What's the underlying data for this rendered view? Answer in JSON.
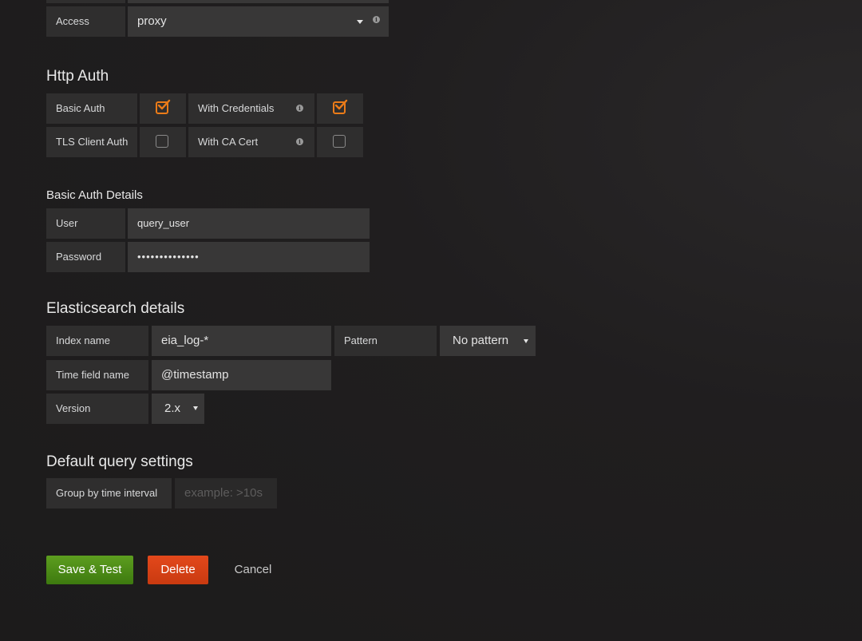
{
  "access": {
    "label": "Access",
    "value": "proxy"
  },
  "http_auth": {
    "title": "Http Auth",
    "basic_auth": {
      "label": "Basic Auth",
      "checked": true
    },
    "with_credentials": {
      "label": "With Credentials",
      "checked": true
    },
    "tls_client_auth": {
      "label": "TLS Client Auth",
      "checked": false
    },
    "with_ca_cert": {
      "label": "With CA Cert",
      "checked": false
    }
  },
  "basic_auth_details": {
    "title": "Basic Auth Details",
    "user_label": "User",
    "user_value": "query_user",
    "password_label": "Password",
    "password_value": "••••••••••••••"
  },
  "elasticsearch": {
    "title": "Elasticsearch details",
    "index_name_label": "Index name",
    "index_name_value": "eia_log-*",
    "pattern_label": "Pattern",
    "pattern_value": "No pattern",
    "time_field_label": "Time field name",
    "time_field_value": "@timestamp",
    "version_label": "Version",
    "version_value": "2.x"
  },
  "default_query": {
    "title": "Default query settings",
    "group_by_label": "Group by time interval",
    "group_by_placeholder": "example: >10s"
  },
  "actions": {
    "save_test": "Save & Test",
    "delete": "Delete",
    "cancel": "Cancel"
  },
  "colors": {
    "accent": "#eb7b18",
    "success": "#4d8b17",
    "danger": "#e0441a"
  }
}
